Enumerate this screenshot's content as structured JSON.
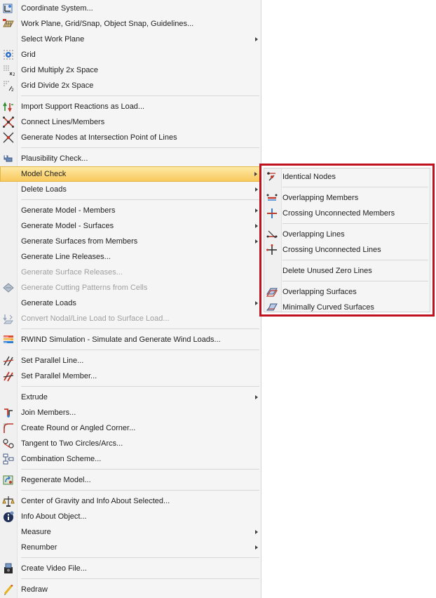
{
  "main_menu": {
    "items": [
      {
        "label": "Coordinate System...",
        "icon": "coordinate-system-icon",
        "enabled": true,
        "submenu": false
      },
      {
        "label": "Work Plane, Grid/Snap, Object Snap, Guidelines...",
        "icon": "work-plane-icon",
        "enabled": true,
        "submenu": false
      },
      {
        "label": "Select Work Plane",
        "icon": "",
        "enabled": true,
        "submenu": true
      },
      {
        "label": "Grid",
        "icon": "grid-icon",
        "enabled": true,
        "submenu": false
      },
      {
        "label": "Grid Multiply 2x Space",
        "icon": "grid-multiply-icon",
        "enabled": true,
        "submenu": false
      },
      {
        "label": "Grid Divide 2x Space",
        "icon": "grid-divide-icon",
        "enabled": true,
        "submenu": false
      },
      {
        "label": "Import Support Reactions as Load...",
        "icon": "import-reactions-icon",
        "enabled": true,
        "submenu": false
      },
      {
        "label": "Connect Lines/Members",
        "icon": "connect-lines-icon",
        "enabled": true,
        "submenu": false
      },
      {
        "label": "Generate Nodes at Intersection Point of Lines",
        "icon": "intersection-nodes-icon",
        "enabled": true,
        "submenu": false
      },
      {
        "label": "Plausibility Check...",
        "icon": "plausibility-check-icon",
        "enabled": true,
        "submenu": false
      },
      {
        "label": "Model Check",
        "icon": "",
        "enabled": true,
        "submenu": true,
        "highlighted": true
      },
      {
        "label": "Delete Loads",
        "icon": "",
        "enabled": true,
        "submenu": true
      },
      {
        "label": "Generate Model - Members",
        "icon": "",
        "enabled": true,
        "submenu": true
      },
      {
        "label": "Generate Model - Surfaces",
        "icon": "",
        "enabled": true,
        "submenu": true
      },
      {
        "label": "Generate Surfaces from Members",
        "icon": "",
        "enabled": true,
        "submenu": true
      },
      {
        "label": "Generate Line Releases...",
        "icon": "",
        "enabled": true,
        "submenu": false
      },
      {
        "label": "Generate Surface Releases...",
        "icon": "",
        "enabled": false,
        "submenu": false
      },
      {
        "label": "Generate Cutting Patterns from Cells",
        "icon": "cutting-pattern-icon",
        "enabled": false,
        "submenu": false
      },
      {
        "label": "Generate Loads",
        "icon": "",
        "enabled": true,
        "submenu": true
      },
      {
        "label": "Convert Nodal/Line Load to Surface Load...",
        "icon": "convert-load-icon",
        "enabled": false,
        "submenu": false
      },
      {
        "label": "RWIND Simulation - Simulate and Generate Wind Loads...",
        "icon": "rwind-icon",
        "enabled": true,
        "submenu": false
      },
      {
        "label": "Set Parallel Line...",
        "icon": "parallel-line-icon",
        "enabled": true,
        "submenu": false
      },
      {
        "label": "Set Parallel Member...",
        "icon": "parallel-member-icon",
        "enabled": true,
        "submenu": false
      },
      {
        "label": "Extrude",
        "icon": "",
        "enabled": true,
        "submenu": true
      },
      {
        "label": "Join Members...",
        "icon": "join-members-icon",
        "enabled": true,
        "submenu": false
      },
      {
        "label": "Create Round or Angled Corner...",
        "icon": "round-corner-icon",
        "enabled": true,
        "submenu": false
      },
      {
        "label": "Tangent to Two Circles/Arcs...",
        "icon": "tangent-icon",
        "enabled": true,
        "submenu": false
      },
      {
        "label": "Combination Scheme...",
        "icon": "combination-scheme-icon",
        "enabled": true,
        "submenu": false
      },
      {
        "label": "Regenerate Model...",
        "icon": "regenerate-icon",
        "enabled": true,
        "submenu": false
      },
      {
        "label": "Center of Gravity and Info About Selected...",
        "icon": "center-gravity-icon",
        "enabled": true,
        "submenu": false
      },
      {
        "label": "Info About Object...",
        "icon": "info-icon",
        "enabled": true,
        "submenu": false
      },
      {
        "label": "Measure",
        "icon": "",
        "enabled": true,
        "submenu": true
      },
      {
        "label": "Renumber",
        "icon": "",
        "enabled": true,
        "submenu": true
      },
      {
        "label": "Create Video File...",
        "icon": "video-file-icon",
        "enabled": true,
        "submenu": false
      },
      {
        "label": "Redraw",
        "icon": "redraw-icon",
        "enabled": true,
        "submenu": false
      }
    ]
  },
  "model_check_submenu": {
    "items": [
      {
        "label": "Identical Nodes",
        "icon": "identical-nodes-icon"
      },
      {
        "label": "Overlapping Members",
        "icon": "overlapping-members-icon"
      },
      {
        "label": "Crossing Unconnected Members",
        "icon": "crossing-members-icon"
      },
      {
        "label": "Overlapping Lines",
        "icon": "overlapping-lines-icon"
      },
      {
        "label": "Crossing Unconnected Lines",
        "icon": "crossing-lines-icon"
      },
      {
        "label": "Delete Unused Zero Lines",
        "icon": ""
      },
      {
        "label": "Overlapping Surfaces",
        "icon": "overlapping-surfaces-icon"
      },
      {
        "label": "Minimally Curved Surfaces",
        "icon": "curved-surfaces-icon"
      }
    ]
  },
  "colors": {
    "highlight": "#f9c95d",
    "callout_border": "#c0111f",
    "disabled_text": "#a0a0a0"
  }
}
